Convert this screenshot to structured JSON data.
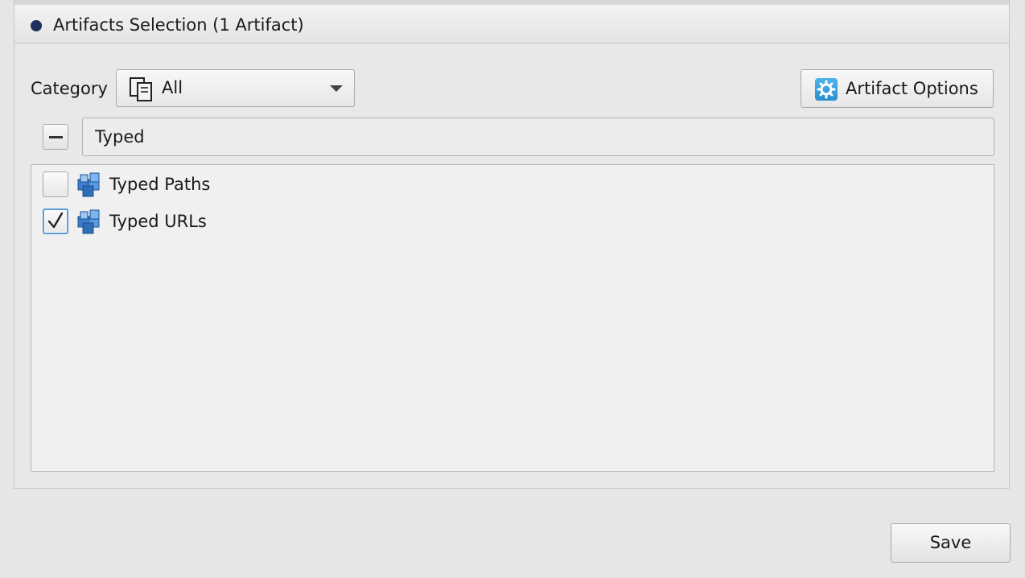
{
  "panel": {
    "title": "Artifacts Selection (1 Artifact)"
  },
  "category": {
    "label": "Category",
    "selected": "All"
  },
  "options_button": {
    "label": "Artifact Options"
  },
  "search": {
    "value": "Typed"
  },
  "artifacts": [
    {
      "label": "Typed Paths",
      "checked": false
    },
    {
      "label": "Typed URLs",
      "checked": true
    }
  ],
  "save_button": {
    "label": "Save"
  },
  "icons": {
    "header_bullet": "bullet-icon",
    "category": "category-all-icon",
    "options": "gear-icon",
    "collapse": "minus-icon",
    "artifact": "artifact-cubes-icon",
    "check": "checkmark-icon"
  },
  "colors": {
    "accent": "#5a9bd6",
    "header_bullet": "#1e2f5b",
    "gear": "#2a8fd0"
  }
}
